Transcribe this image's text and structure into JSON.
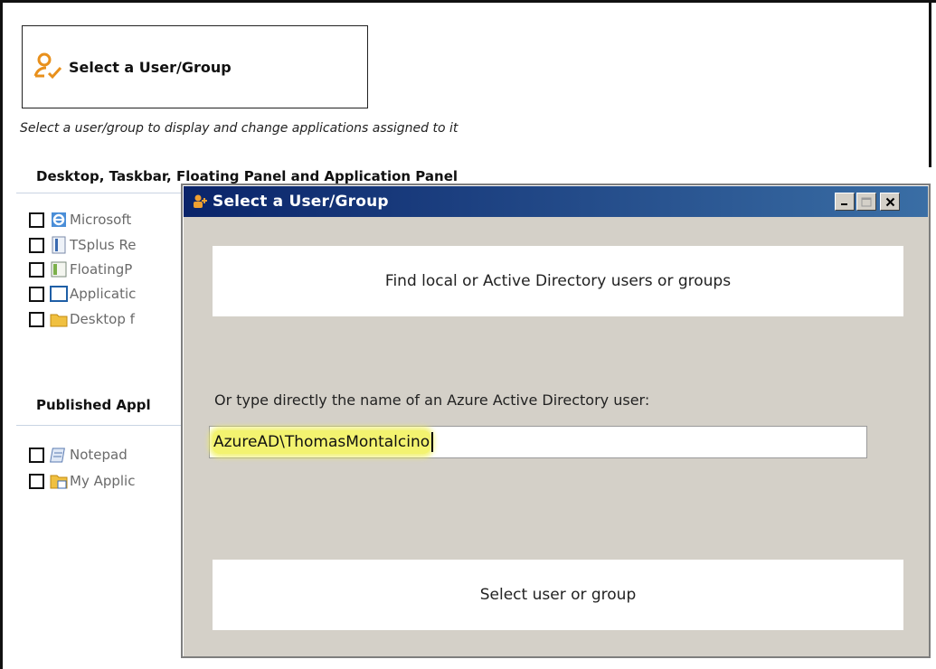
{
  "header_button": {
    "label": "Select a User/Group",
    "icon": "user-check-icon"
  },
  "hint": "Select a user/group to display and change applications assigned to it",
  "sections": {
    "desktop": {
      "title": "Desktop, Taskbar, Floating Panel and Application Panel",
      "items": [
        {
          "label": "Microsoft",
          "icon": "ie-icon"
        },
        {
          "label": "TSplus Re",
          "icon": "remote-taskbar-icon"
        },
        {
          "label": "FloatingP",
          "icon": "floating-panel-icon"
        },
        {
          "label": "Applicatic",
          "icon": "application-panel-icon"
        },
        {
          "label": "Desktop f",
          "icon": "folder-icon"
        }
      ]
    },
    "published": {
      "title": "Published Appl",
      "items": [
        {
          "label": "Notepad",
          "icon": "notepad-icon"
        },
        {
          "label": "My Applic",
          "icon": "my-applications-icon"
        }
      ]
    }
  },
  "dialog": {
    "title": "Select a User/Group",
    "find_button": "Find local or Active Directory users or groups",
    "azure_label": "Or type directly the name of an Azure Active Directory user:",
    "azure_value": "AzureAD\\ThomasMontalcino",
    "select_button": "Select user or group"
  },
  "colors": {
    "titlebar": "#0a246a",
    "dialog_bg": "#d4d0c8",
    "highlight": "#f3f370"
  }
}
